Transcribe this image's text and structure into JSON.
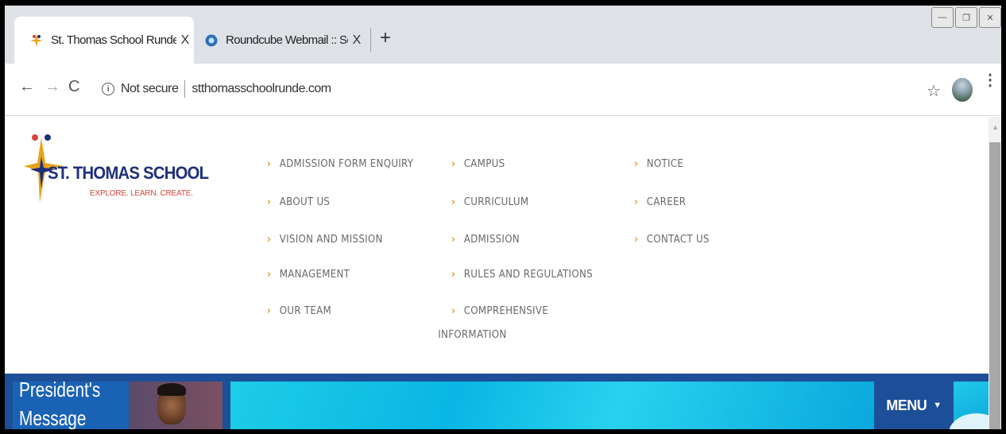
{
  "browser": {
    "tabs": [
      {
        "title": "St. Thomas School Runde CBSE S",
        "close": "X",
        "active": true
      },
      {
        "title": "Roundcube Webmail :: Sent",
        "close": "X",
        "active": false
      }
    ],
    "new_tab": "+",
    "window_controls": {
      "minimize": "—",
      "restore": "❐",
      "close": "✕"
    },
    "nav": {
      "back": "←",
      "forward": "→",
      "reload": "C"
    },
    "address": {
      "security_label": "Not secure",
      "url": "stthomasschoolrunde.com"
    },
    "bookmark_star": "☆",
    "menu": "⋮"
  },
  "site": {
    "logo": {
      "name": "ST. THOMAS SCHOOL",
      "tagline": "EXPLORE. LEARN. CREATE."
    },
    "nav_columns": [
      [
        "ADMISSION FORM ENQUIRY",
        "ABOUT US",
        "VISION AND MISSION",
        "MANAGEMENT",
        "OUR TEAM"
      ],
      [
        "CAMPUS",
        "CURRICULUM",
        "ADMISSION",
        "RULES AND REGULATIONS",
        "COMPREHENSIVE",
        "INFORMATION"
      ],
      [
        "NOTICE",
        "CAREER",
        "CONTACT US"
      ]
    ],
    "chevron": "›",
    "banner": {
      "presidents_line1": "President's",
      "presidents_line2": "Message",
      "menu_label": "MENU",
      "menu_caret": "▼"
    }
  },
  "colors": {
    "logo_blue": "#1e2f7a",
    "tagline_red": "#d6473a",
    "chevron_orange": "#e69a1d",
    "banner_blue": "#1d4f98",
    "cyan": "#0ab6e4"
  }
}
